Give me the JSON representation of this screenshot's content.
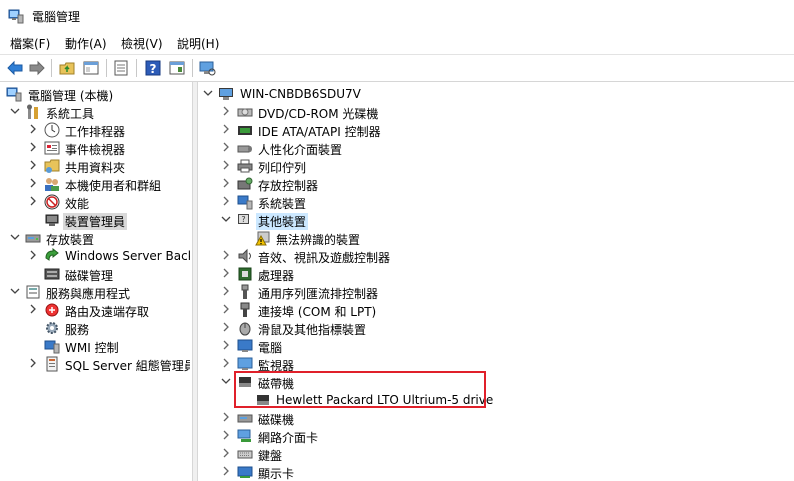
{
  "window": {
    "title": "電腦管理"
  },
  "menu": [
    "檔案(F)",
    "動作(A)",
    "檢視(V)",
    "說明(H)"
  ],
  "left_tree": {
    "root": "電腦管理 (本機)",
    "system_tools": "系統工具",
    "task_scheduler": "工作排程器",
    "event_viewer": "事件檢視器",
    "shared_folders": "共用資料夾",
    "local_users": "本機使用者和群組",
    "performance": "效能",
    "device_manager": "裝置管理員",
    "storage": "存放裝置",
    "backup": "Windows Server Backu",
    "disk_management": "磁碟管理",
    "services_apps": "服務與應用程式",
    "routing": "路由及遠端存取",
    "services": "服務",
    "wmi": "WMI 控制",
    "sql": "SQL Server 組態管理員"
  },
  "right_tree": {
    "computer": "WIN-CNBDB6SDU7V",
    "dvd": "DVD/CD-ROM 光碟機",
    "ide": "IDE ATA/ATAPI 控制器",
    "hid": "人性化介面裝置",
    "print_queue": "列印佇列",
    "storage_ctrl": "存放控制器",
    "system_devices": "系統裝置",
    "other_devices": "其他裝置",
    "unknown_device": "無法辨識的裝置",
    "audio": "音效、視訊及遊戲控制器",
    "processors": "處理器",
    "usb": "通用序列匯流排控制器",
    "ports": "連接埠 (COM 和 LPT)",
    "mice": "滑鼠及其他指標裝置",
    "computer_node": "電腦",
    "monitors": "監視器",
    "tape_drives": "磁帶機",
    "tape_drive_item": "Hewlett Packard LTO Ultrium-5 drive",
    "disk_drives": "磁碟機",
    "network_adapters": "網路介面卡",
    "keyboards": "鍵盤",
    "display_adapters": "顯示卡"
  }
}
